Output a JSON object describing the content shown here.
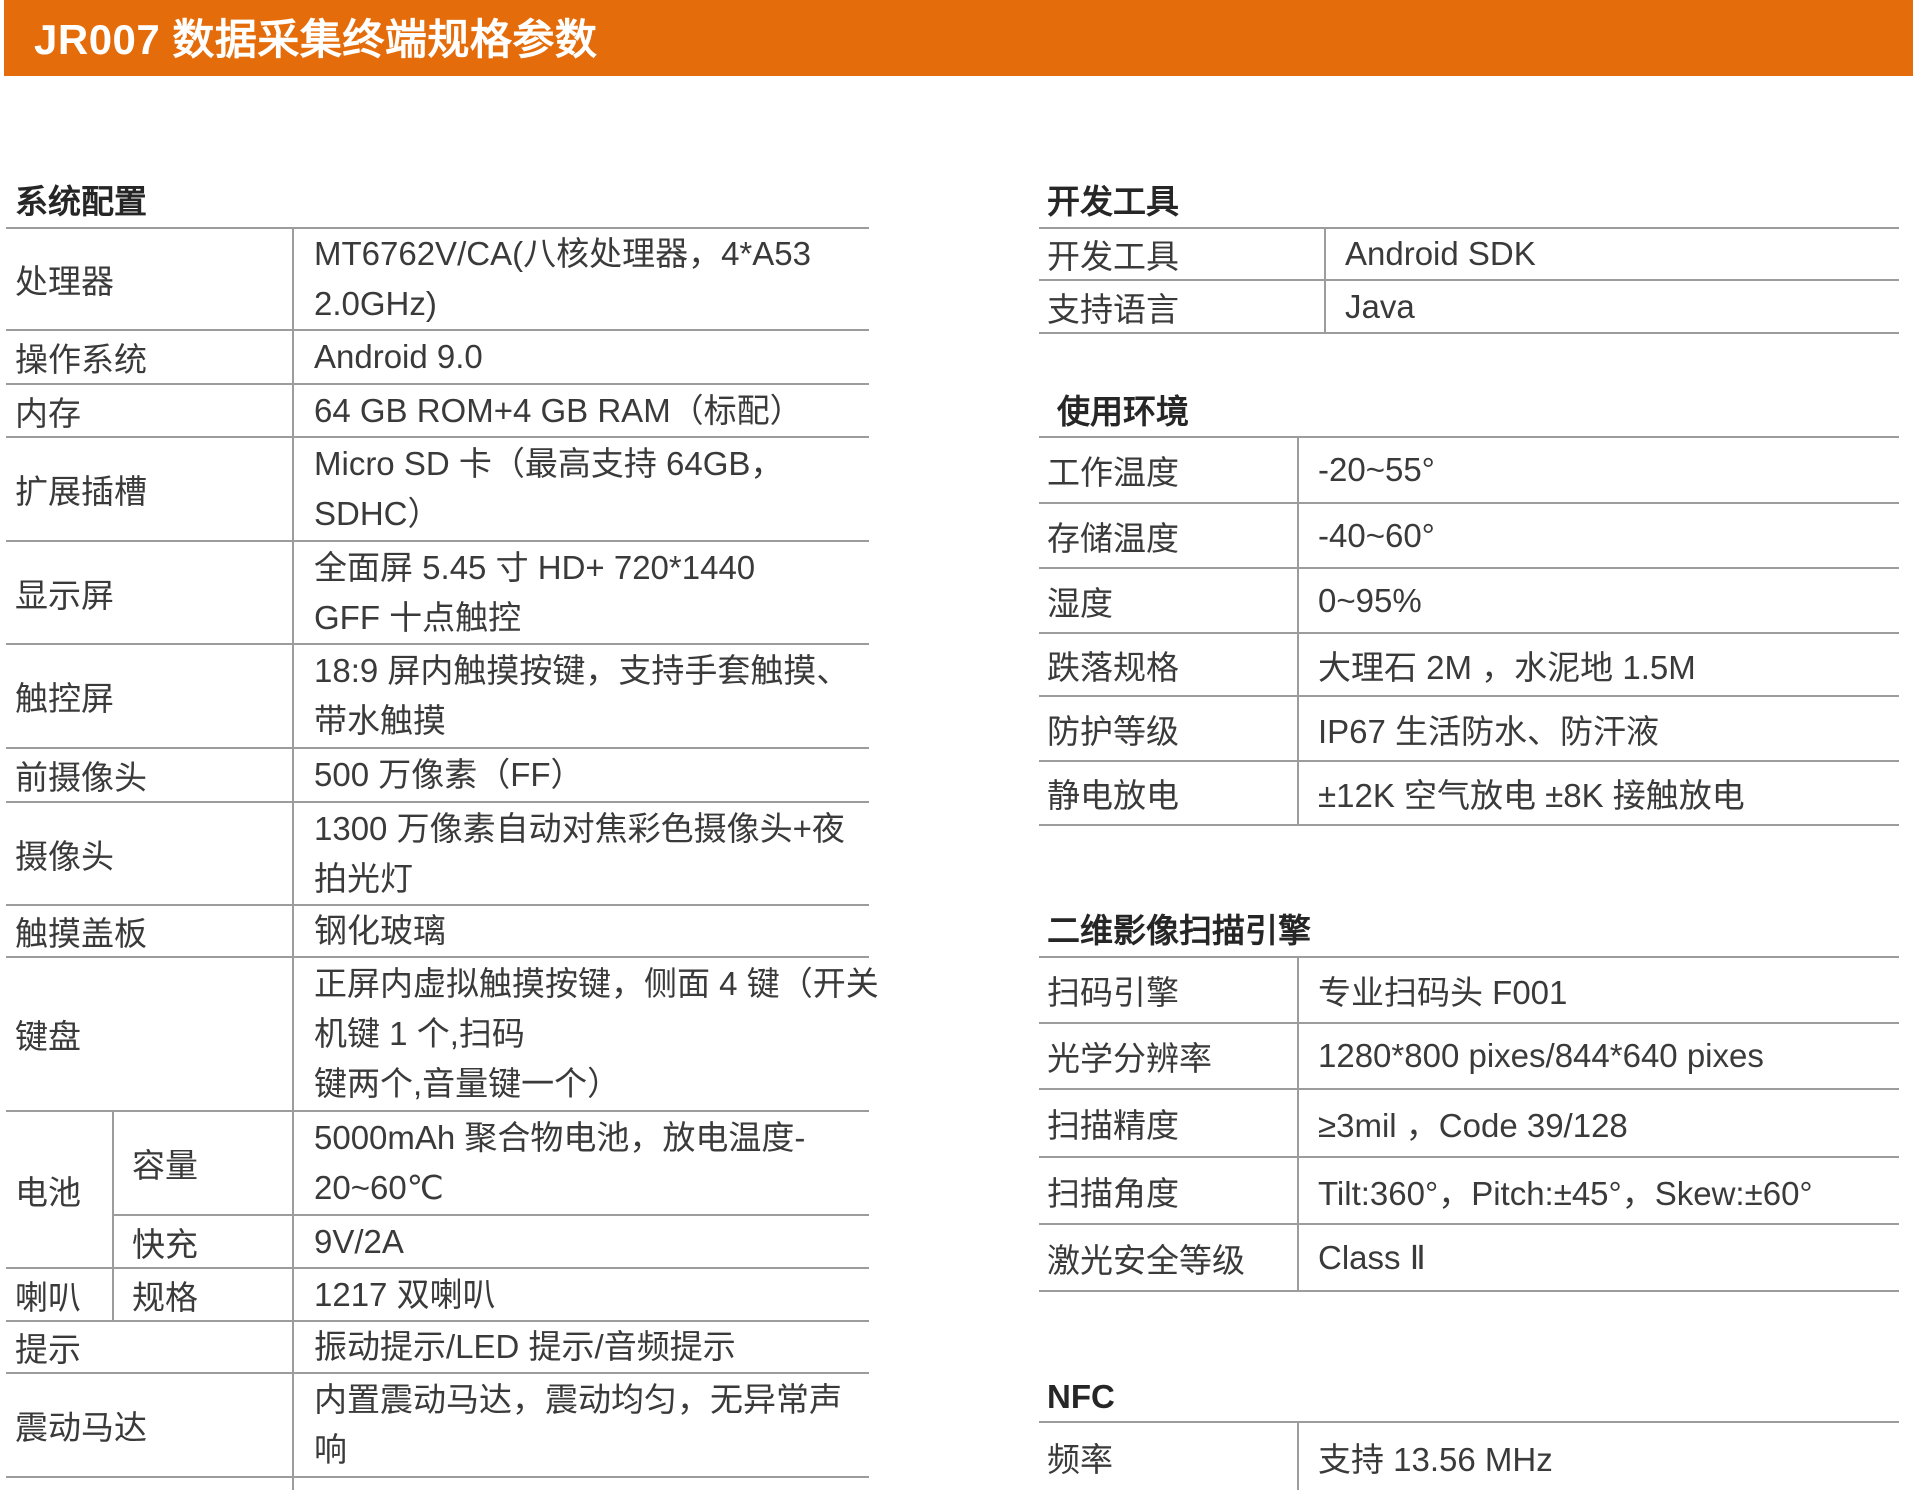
{
  "header": {
    "title": "JR007 数据采集终端规格参数"
  },
  "colors": {
    "header_bg": "#E46C0A",
    "header_text": "#FFFFFF",
    "rule": "#9C9C9C",
    "body_text": "#3A3A3A",
    "heading_text": "#262626"
  },
  "system": {
    "heading": "系统配置",
    "rows": [
      {
        "label": "处理器",
        "value": [
          "MT6762V/CA(八核处理器，4*A53",
          "2.0GHz)"
        ]
      },
      {
        "label": "操作系统",
        "value": [
          "Android 9.0"
        ]
      },
      {
        "label": "内存",
        "value": [
          "64 GB ROM+4 GB RAM（标配）"
        ]
      },
      {
        "label": "扩展插槽",
        "value": [
          "Micro SD 卡（最高支持 64GB，",
          "SDHC）"
        ]
      },
      {
        "label": "显示屏",
        "value": [
          "全面屏 5.45 寸 HD+ 720*1440",
          "GFF 十点触控"
        ]
      },
      {
        "label": "触控屏",
        "value": [
          "18:9 屏内触摸按键，支持手套触摸、",
          "带水触摸"
        ]
      },
      {
        "label": "前摄像头",
        "value": [
          "500 万像素（FF）"
        ]
      },
      {
        "label": "摄像头",
        "value": [
          "1300 万像素自动对焦彩色摄像头+夜",
          "拍光灯"
        ]
      },
      {
        "label": "触摸盖板",
        "value": [
          "钢化玻璃"
        ]
      },
      {
        "label": "键盘",
        "value": [
          "正屏内虚拟触摸按键，侧面 4 键（开关",
          "机键 1 个,扫码",
          "键两个,音量键一个）"
        ]
      }
    ],
    "battery": {
      "label": "电池",
      "capacity_label": "容量",
      "capacity_value": [
        "5000mAh 聚合物电池，放电温度-",
        "20~60℃"
      ],
      "fast_charge_label": "快充",
      "fast_charge_value": "9V/2A"
    },
    "speaker": {
      "label": "喇叭",
      "spec_label": "规格",
      "spec_value": "1217 双喇叭"
    },
    "rows_after": [
      {
        "label": "提示",
        "value": [
          "振动提示/LED 提示/音频提示"
        ]
      },
      {
        "label": "震动马达",
        "value": [
          "内置震动马达，震动均匀，无异常声",
          "响"
        ]
      }
    ]
  },
  "dev_tools": {
    "heading": "开发工具",
    "rows": [
      {
        "label": "开发工具",
        "value": "Android SDK"
      },
      {
        "label": "支持语言",
        "value": "Java"
      }
    ]
  },
  "environment": {
    "heading": "使用环境",
    "rows": [
      {
        "label": "工作温度",
        "value": "-20~55°"
      },
      {
        "label": "存储温度",
        "value": "-40~60°"
      },
      {
        "label": "湿度",
        "value": "0~95%"
      },
      {
        "label": "跌落规格",
        "value": "大理石 2M ，水泥地 1.5M"
      },
      {
        "label": "防护等级",
        "value": "IP67 生活防水、防汗液"
      },
      {
        "label": "静电放电",
        "value": "±12K 空气放电 ±8K 接触放电"
      }
    ]
  },
  "scan_engine": {
    "heading": "二维影像扫描引擎",
    "rows": [
      {
        "label": "扫码引擎",
        "value": "专业扫码头 F001"
      },
      {
        "label": "光学分辨率",
        "value": "1280*800 pixes/844*640 pixes"
      },
      {
        "label": "扫描精度",
        "value": "≥3mil ，Code 39/128"
      },
      {
        "label": "扫描角度",
        "value": "Tilt:360°，Pitch:±45°，Skew:±60°"
      },
      {
        "label": "激光安全等级",
        "value": "Class Ⅱ"
      }
    ]
  },
  "nfc": {
    "heading": "NFC",
    "rows": [
      {
        "label": "频率",
        "value": "支持 13.56 MHz"
      }
    ]
  }
}
